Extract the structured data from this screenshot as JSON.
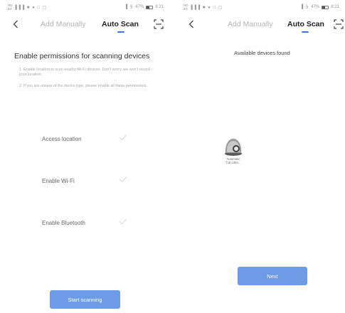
{
  "left_screen": {
    "status_bar": {
      "network_top": "HD",
      "network_bottom": "4G",
      "icons": "▐▐▐ ■ ● □ ▢",
      "right_icons": "▐ §",
      "battery_text": "47%",
      "battery_level": 0.47,
      "time": "8:21"
    },
    "header": {
      "tab_manual": "Add Manually",
      "tab_auto": "Auto Scan"
    },
    "title": "Enable permissions for scanning devices",
    "notes": [
      "1. Enable location to scan nearby Wi-Fi devices. Don't worry, we won't record your location.",
      "2. If you are unsure of the device type, please enable all these permissions."
    ],
    "permissions": [
      {
        "label": "Access location"
      },
      {
        "label": "Enable Wi-Fi"
      },
      {
        "label": "Enable Bluetooth"
      }
    ],
    "start_button": "Start scanning"
  },
  "right_screen": {
    "status_bar": {
      "network_top": "HD",
      "network_bottom": "4G",
      "icons": "▐▐▐ ■ ● □ ▢",
      "right_icons": "▐ §",
      "battery_text": "47%",
      "battery_level": 0.47,
      "time": "8:21"
    },
    "header": {
      "tab_manual": "Add Manually",
      "tab_auto": "Auto Scan"
    },
    "title": "Available devices found",
    "device": {
      "name_line1": "Automatic",
      "name_line2": "Cat Litter..."
    },
    "next_button": "Next"
  },
  "colors": {
    "accent": "#3a76d6",
    "button": "#6e9be5",
    "check": "#d8d8d8"
  }
}
